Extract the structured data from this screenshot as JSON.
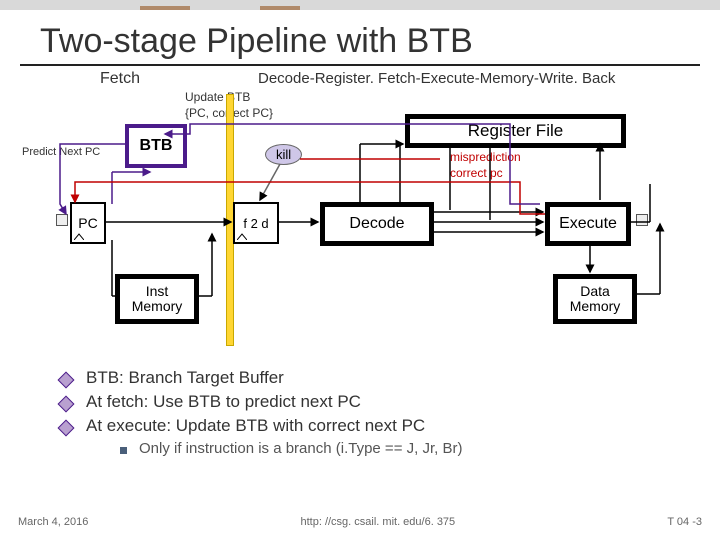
{
  "title": "Two-stage Pipeline with BTB",
  "stage_fetch": "Fetch",
  "stage_rest": "Decode-Register. Fetch-Execute-Memory-Write. Back",
  "update_btb_l1": "Update BTB",
  "update_btb_l2": "{PC, correct PC}",
  "predict_next_pc": "Predict Next PC",
  "btb": "BTB",
  "kill": "kill",
  "register_file": "Register File",
  "mispred_l1": "misprediction",
  "mispred_l2": "correct pc",
  "pc": "PC",
  "f2d": "f 2 d",
  "decode": "Decode",
  "execute": "Execute",
  "inst_mem_l1": "Inst",
  "inst_mem_l2": "Memory",
  "data_mem_l1": "Data",
  "data_mem_l2": "Memory",
  "bullets": {
    "a": "BTB: Branch Target Buffer",
    "b": "At fetch: Use BTB to predict next PC",
    "c": "At execute: Update BTB with correct next PC",
    "sub": "Only if instruction is a branch (i.Type == J, Jr, Br)"
  },
  "footer": {
    "date": "March 4, 2016",
    "url": "http: //csg. csail. mit. edu/6. 375",
    "slide": "T 04 -3"
  }
}
